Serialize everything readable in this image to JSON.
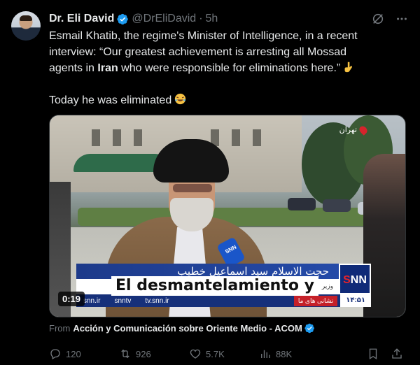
{
  "tweet": {
    "author_name": "Dr. Eli David",
    "handle": "@DrEliDavid",
    "separator": "·",
    "time": "5h",
    "text_line_1": "Esmail Khatib, the regime's Minister of Intelligence, in a recent",
    "text_line_2": "interview: “Our greatest achievement is arresting all Mossad",
    "text_line_3a": "agents in ",
    "text_line_3_bold": "Iran",
    "text_line_3b": " who were responsible for eliminations here.”",
    "text_line_4": "Today he was eliminated",
    "emoji_1": "pointing-down-icon",
    "emoji_2": "rolling-laughing-icon"
  },
  "media": {
    "location_label": "تهران",
    "lower_third_title": "حجت الاسلام سید اسماعیل خطیب",
    "lower_third_small": "وزیر",
    "logo_text_s": "S",
    "logo_text_nn": "NN",
    "ticker_left": "snn.ir",
    "ticker_mid1": "snntv",
    "ticker_mid2": "tv.snn.ir",
    "ticker_pill": "نشانی های ما",
    "ticker_clock": "۱۴:۵۱",
    "subtitle": "El desmantelamiento y",
    "mic_label": "SNN",
    "duration": "0:19",
    "accent_blue": "#1d3a8a",
    "accent_red": "#e4232b"
  },
  "attribution": {
    "prefix": "From",
    "source": "Acción y Comunicación sobre Oriente Medio - ACOM"
  },
  "actions": {
    "replies": "120",
    "retweets": "926",
    "likes": "5.7K",
    "views": "88K"
  },
  "colors": {
    "background": "#000000",
    "text": "#e7e9ea",
    "muted": "#71767b",
    "verified": "#1d9bf0"
  }
}
